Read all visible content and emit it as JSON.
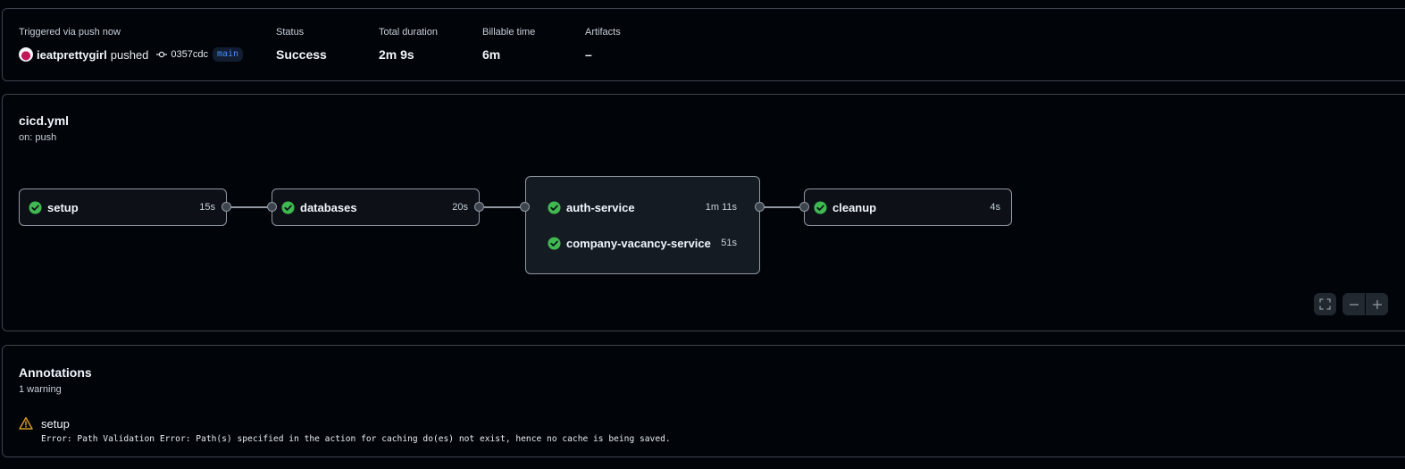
{
  "summary": {
    "trigger_label": "Triggered via push now",
    "actor": "ieatprettygirl",
    "action": "pushed",
    "commit_sha": "0357cdc",
    "branch": "main",
    "status_label": "Status",
    "status_value": "Success",
    "duration_label": "Total duration",
    "duration_value": "2m 9s",
    "billable_label": "Billable time",
    "billable_value": "6m",
    "artifacts_label": "Artifacts",
    "artifacts_value": "–"
  },
  "workflow": {
    "file": "cicd.yml",
    "trigger": "on: push",
    "jobs": [
      {
        "name": "setup",
        "duration": "15s",
        "status": "success"
      },
      {
        "name": "databases",
        "duration": "20s",
        "status": "success"
      },
      {
        "name": "auth-service",
        "duration": "1m 11s",
        "status": "success"
      },
      {
        "name": "company-vacancy-service",
        "duration": "51s",
        "status": "success"
      },
      {
        "name": "cleanup",
        "duration": "4s",
        "status": "success"
      }
    ]
  },
  "annotations": {
    "title": "Annotations",
    "count": "1 warning",
    "items": [
      {
        "level": "warning",
        "job": "setup",
        "message": "Error: Path Validation Error: Path(s) specified in the action for caching do(es) not exist, hence no cache is being saved."
      }
    ]
  },
  "colors": {
    "success": "#3fb950",
    "warning": "#d29922",
    "branch": "#4493f8",
    "background": "#010409",
    "border": "#3d444d"
  },
  "icons": {
    "commit": "git-commit-icon",
    "job_status": "check-circle-icon",
    "warning": "alert-triangle-icon",
    "fullscreen": "fullscreen-icon",
    "zoom_out": "minus-icon",
    "zoom_in": "plus-icon"
  }
}
